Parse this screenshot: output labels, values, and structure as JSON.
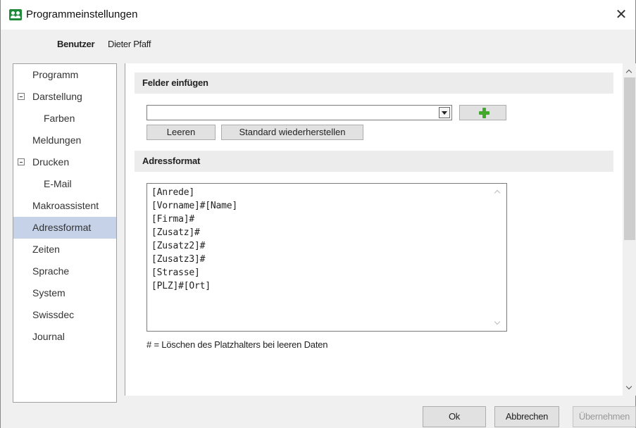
{
  "window": {
    "title": "Programmeinstellungen",
    "close_glyph": "✕",
    "icon": "users-icon"
  },
  "user": {
    "label": "Benutzer",
    "name": "Dieter Pfaff"
  },
  "nav": {
    "items": [
      {
        "label": "Programm",
        "level": 0,
        "expander": false,
        "selected": false
      },
      {
        "label": "Darstellung",
        "level": 0,
        "expander": true,
        "selected": false
      },
      {
        "label": "Farben",
        "level": 1,
        "expander": false,
        "selected": false
      },
      {
        "label": "Meldungen",
        "level": 0,
        "expander": false,
        "selected": false
      },
      {
        "label": "Drucken",
        "level": 0,
        "expander": true,
        "selected": false
      },
      {
        "label": "E-Mail",
        "level": 1,
        "expander": false,
        "selected": false
      },
      {
        "label": "Makroassistent",
        "level": 0,
        "expander": false,
        "selected": false
      },
      {
        "label": "Adressformat",
        "level": 0,
        "expander": false,
        "selected": true
      },
      {
        "label": "Zeiten",
        "level": 0,
        "expander": false,
        "selected": false
      },
      {
        "label": "Sprache",
        "level": 0,
        "expander": false,
        "selected": false
      },
      {
        "label": "System",
        "level": 0,
        "expander": false,
        "selected": false
      },
      {
        "label": "Swissdec",
        "level": 0,
        "expander": false,
        "selected": false
      },
      {
        "label": "Journal",
        "level": 0,
        "expander": false,
        "selected": false
      }
    ]
  },
  "fields": {
    "header": "Felder einfügen",
    "combo_value": "",
    "clear_label": "Leeren",
    "restore_label": "Standard wiederherstellen"
  },
  "address": {
    "header": "Adressformat",
    "text": "[Anrede]\n[Vorname]#[Name]\n[Firma]#\n[Zusatz]#\n[Zusatz2]#\n[Zusatz3]#\n[Strasse]\n[PLZ]#[Ort]",
    "hint": "# = Löschen des Platzhalters bei leeren Daten"
  },
  "footer": {
    "ok_label": "Ok",
    "cancel_label": "Abbrechen",
    "apply_label": "Übernehmen"
  },
  "colors": {
    "selection": "#c6d2e8",
    "plus_icon": "#43a82c",
    "app_icon": "#1f8a3a"
  }
}
